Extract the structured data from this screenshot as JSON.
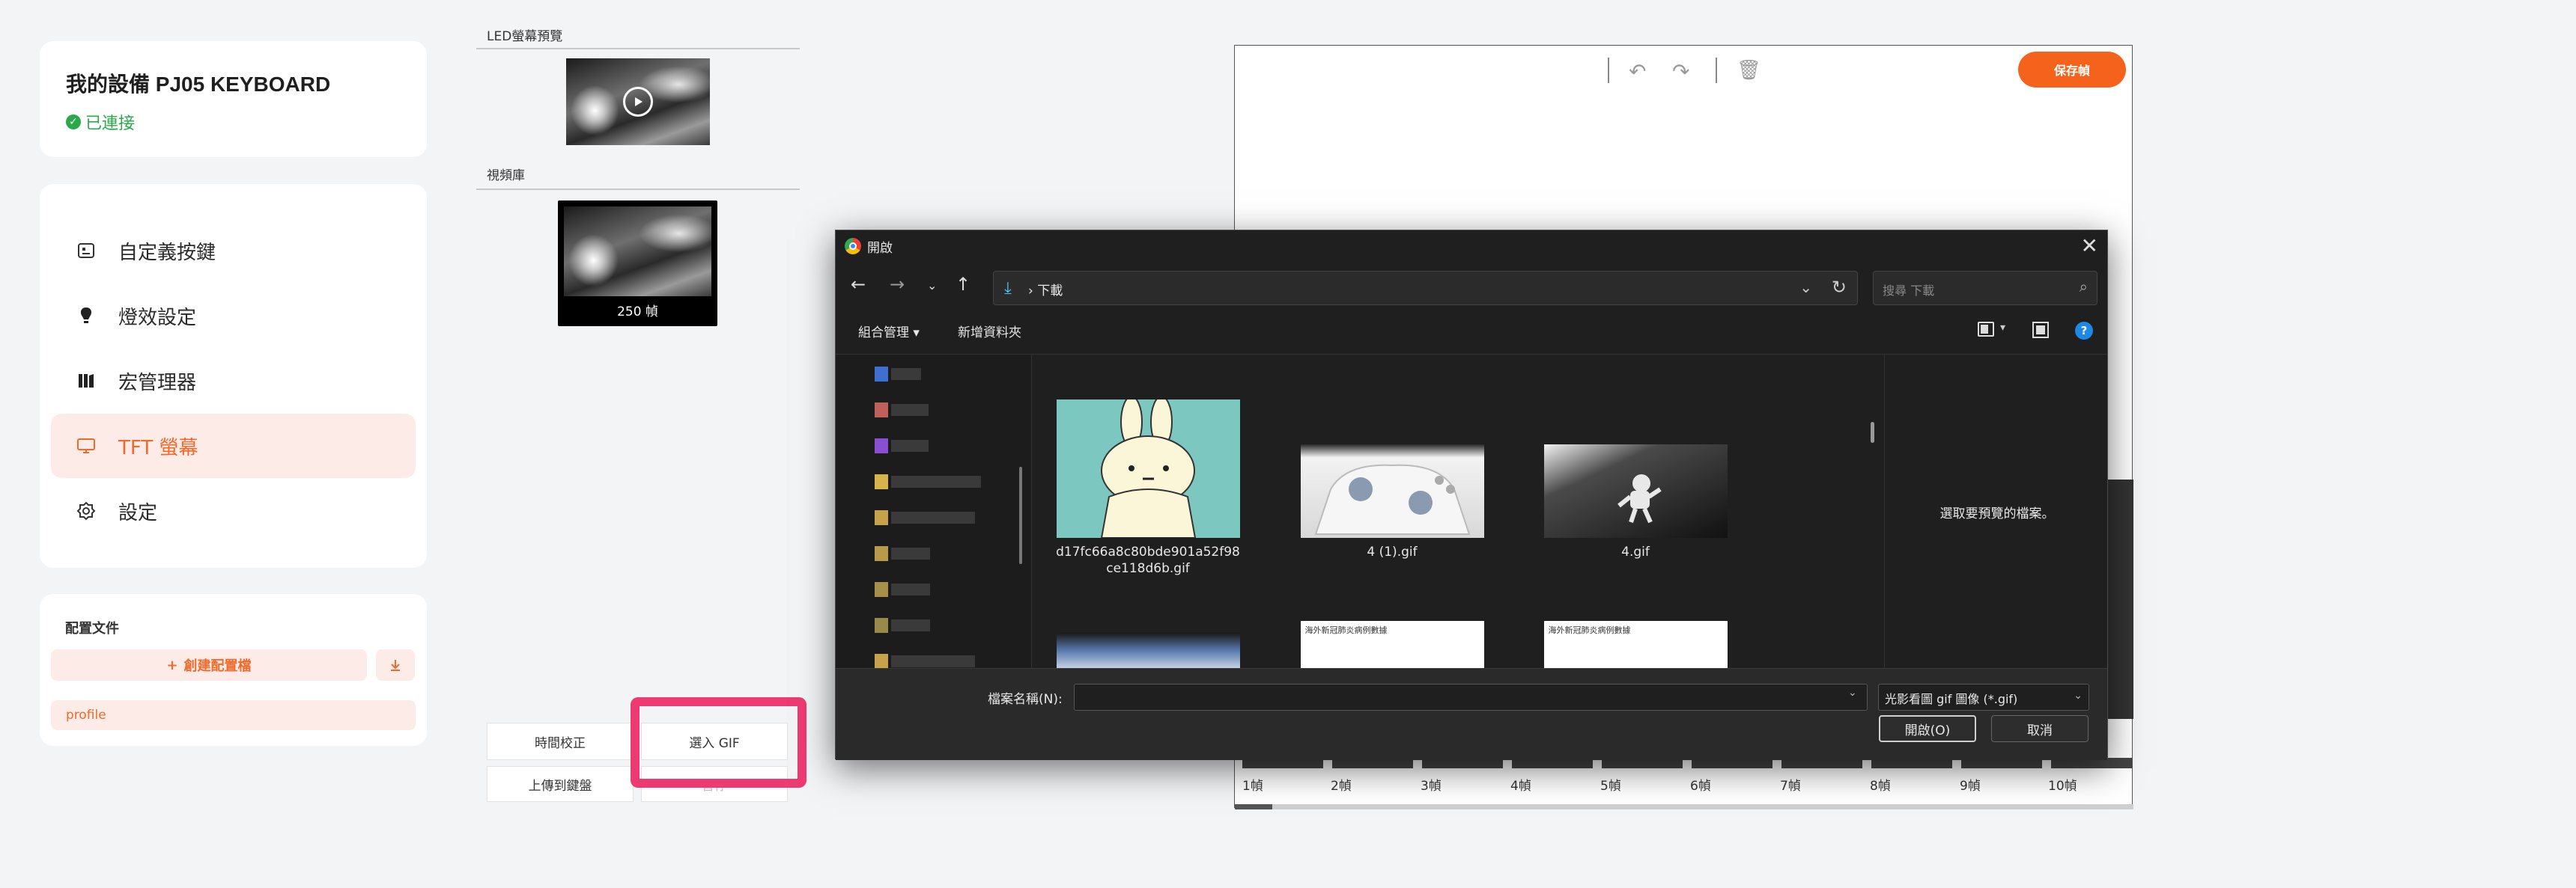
{
  "device": {
    "name": "我的設備 PJ05 KEYBOARD",
    "status": "已連接",
    "status_color": "#2ba84a"
  },
  "nav": {
    "items": [
      {
        "label": "自定義按鍵",
        "icon": "keyboard-icon",
        "active": false
      },
      {
        "label": "燈效設定",
        "icon": "bulb-icon",
        "active": false
      },
      {
        "label": "宏管理器",
        "icon": "macro-icon",
        "active": false
      },
      {
        "label": "TFT 螢幕",
        "icon": "monitor-icon",
        "active": true
      },
      {
        "label": "設定",
        "icon": "gear-icon",
        "active": false
      }
    ]
  },
  "profiles": {
    "title": "配置文件",
    "create_label": "創建配置檔",
    "items": [
      "profile"
    ]
  },
  "middle": {
    "preview_label": "LED螢幕預覽",
    "library_label": "視頻庫",
    "library_frames": "250 幀",
    "time_sync_label": "時間校正",
    "import_gif_label": "選入 GIF",
    "upload_label": "上傳到鍵盤",
    "hidden_btn_label": "暫停"
  },
  "editor": {
    "save_label": "保存幀",
    "frames": [
      "1幀",
      "2幀",
      "3幀",
      "4幀",
      "5幀",
      "6幀",
      "7幀",
      "8幀",
      "9幀",
      "10幀"
    ],
    "accent": "#f5621c"
  },
  "dialog": {
    "title": "開啟",
    "path_current": "下載",
    "search_placeholder": "搜尋 下載",
    "organize_label": "組合管理",
    "new_folder_label": "新增資料夾",
    "help_symbol": "?",
    "files": [
      {
        "name": "d17fc66a8c80bde901a52f98ce118d6b.gif",
        "thumb": "bunny"
      },
      {
        "name": "4 (1).gif",
        "thumb": "controller"
      },
      {
        "name": "4.gif",
        "thumb": "astronaut"
      },
      {
        "name": "",
        "thumb": "blue"
      },
      {
        "name": "",
        "thumb": "doc"
      },
      {
        "name": "",
        "thumb": "doc"
      }
    ],
    "doc_thumb_caption": "海外新冠肺炎病例數據",
    "preview_message": "選取要預覽的檔案。",
    "filename_label": "檔案名稱(N):",
    "filename_value": "",
    "filter_value": "光影看圖 gif 圖像 (*.gif)",
    "open_label": "開啟(O)",
    "cancel_label": "取消"
  },
  "highlight_color": "#ee3a73"
}
